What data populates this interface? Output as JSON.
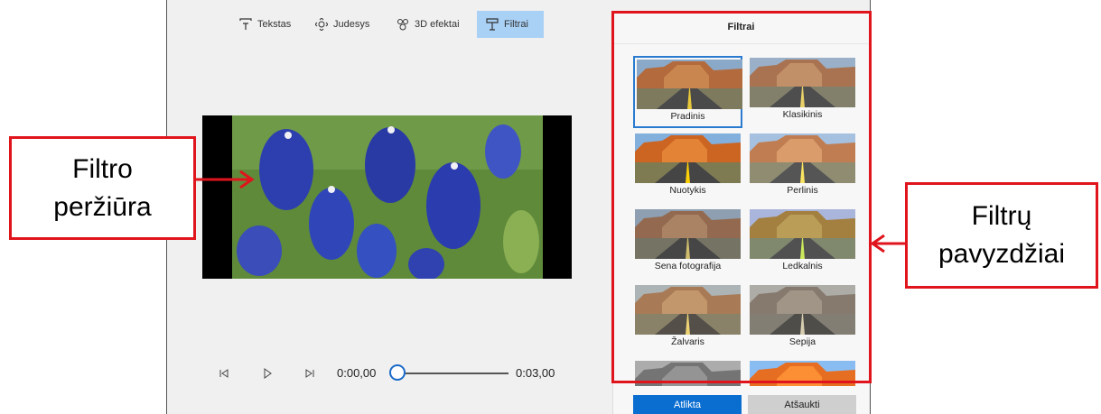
{
  "toolbar": {
    "items": [
      {
        "label": "Tekstas",
        "icon": "text-icon"
      },
      {
        "label": "Judesys",
        "icon": "motion-icon"
      },
      {
        "label": "3D efektai",
        "icon": "3d-effects-icon"
      },
      {
        "label": "Filtrai",
        "icon": "filter-icon",
        "active": true
      }
    ]
  },
  "playback": {
    "current_time": "0:00,00",
    "end_time": "0:03,00",
    "progress": 0
  },
  "panel": {
    "title": "Filtrai",
    "filters": [
      {
        "label": "Pradinis",
        "selected": true
      },
      {
        "label": "Klasikinis"
      },
      {
        "label": "Nuotykis"
      },
      {
        "label": "Perlinis"
      },
      {
        "label": "Sena fotografija"
      },
      {
        "label": "Ledkalnis"
      },
      {
        "label": "Žalvaris"
      },
      {
        "label": "Sepija"
      }
    ],
    "done_label": "Atlikta",
    "cancel_label": "Atšaukti"
  },
  "annotations": {
    "preview_callout": [
      "Filtro",
      "peržiūra"
    ],
    "samples_callout": [
      "Filtrų",
      "pavyzdžiai"
    ]
  },
  "colors": {
    "accent": "#0a6ed1",
    "active_tab": "#a9d0f5",
    "annotation_red": "#e0141c"
  }
}
